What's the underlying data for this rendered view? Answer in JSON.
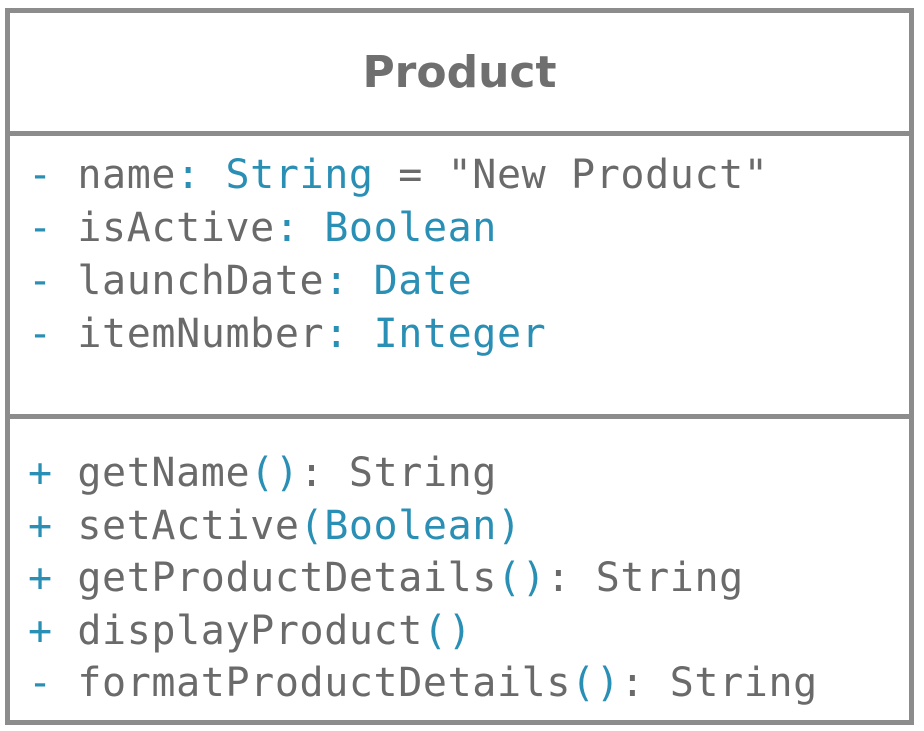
{
  "class": {
    "name": "Product",
    "attributes": [
      {
        "visibility": "-",
        "name": "name",
        "sep": ": ",
        "type": "String",
        "default": " = \"New Product\""
      },
      {
        "visibility": "-",
        "name": "isActive",
        "sep": ": ",
        "type": "Boolean",
        "default": ""
      },
      {
        "visibility": "-",
        "name": "launchDate",
        "sep": ": ",
        "type": "Date",
        "default": ""
      },
      {
        "visibility": "-",
        "name": "itemNumber",
        "sep": ": ",
        "type": "Integer",
        "default": ""
      }
    ],
    "operations": [
      {
        "visibility": "+",
        "name": "getName",
        "params": "()",
        "returns": ": String"
      },
      {
        "visibility": "+",
        "name": "setActive",
        "params": "(Boolean)",
        "returns": ""
      },
      {
        "visibility": "+",
        "name": "getProductDetails",
        "params": "()",
        "returns": ": String"
      },
      {
        "visibility": "+",
        "name": "displayProduct",
        "params": "()",
        "returns": ""
      },
      {
        "visibility": "-",
        "name": "formatProductDetails",
        "params": "()",
        "returns": ": String"
      }
    ]
  },
  "colors": {
    "border": "#8c8c8c",
    "name_text": "#6a6a6a",
    "accent_text": "#2a8fb4"
  }
}
